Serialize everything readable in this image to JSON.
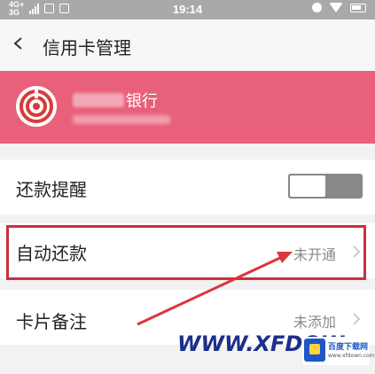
{
  "status_bar": {
    "network_top": "4G+",
    "network_bottom": "3G",
    "time": "19:14"
  },
  "header": {
    "title": "信用卡管理",
    "back_icon": "chevron-left-icon"
  },
  "bank_card": {
    "bank_name_visible": "银行",
    "logo_icon": "bank-logo-icon",
    "background_color": "#e8607a"
  },
  "rows": {
    "repayment_reminder": {
      "label": "还款提醒",
      "toggle_on": false
    },
    "auto_repayment": {
      "label": "自动还款",
      "value": "未开通"
    },
    "card_notes": {
      "label": "卡片备注",
      "value": "未添加"
    }
  },
  "annotation": {
    "highlight_color": "#c9303e"
  },
  "watermark": {
    "text": "WWW.XFDOW",
    "logo_title": "百度下载网",
    "logo_url": "www.xfdown.com"
  }
}
